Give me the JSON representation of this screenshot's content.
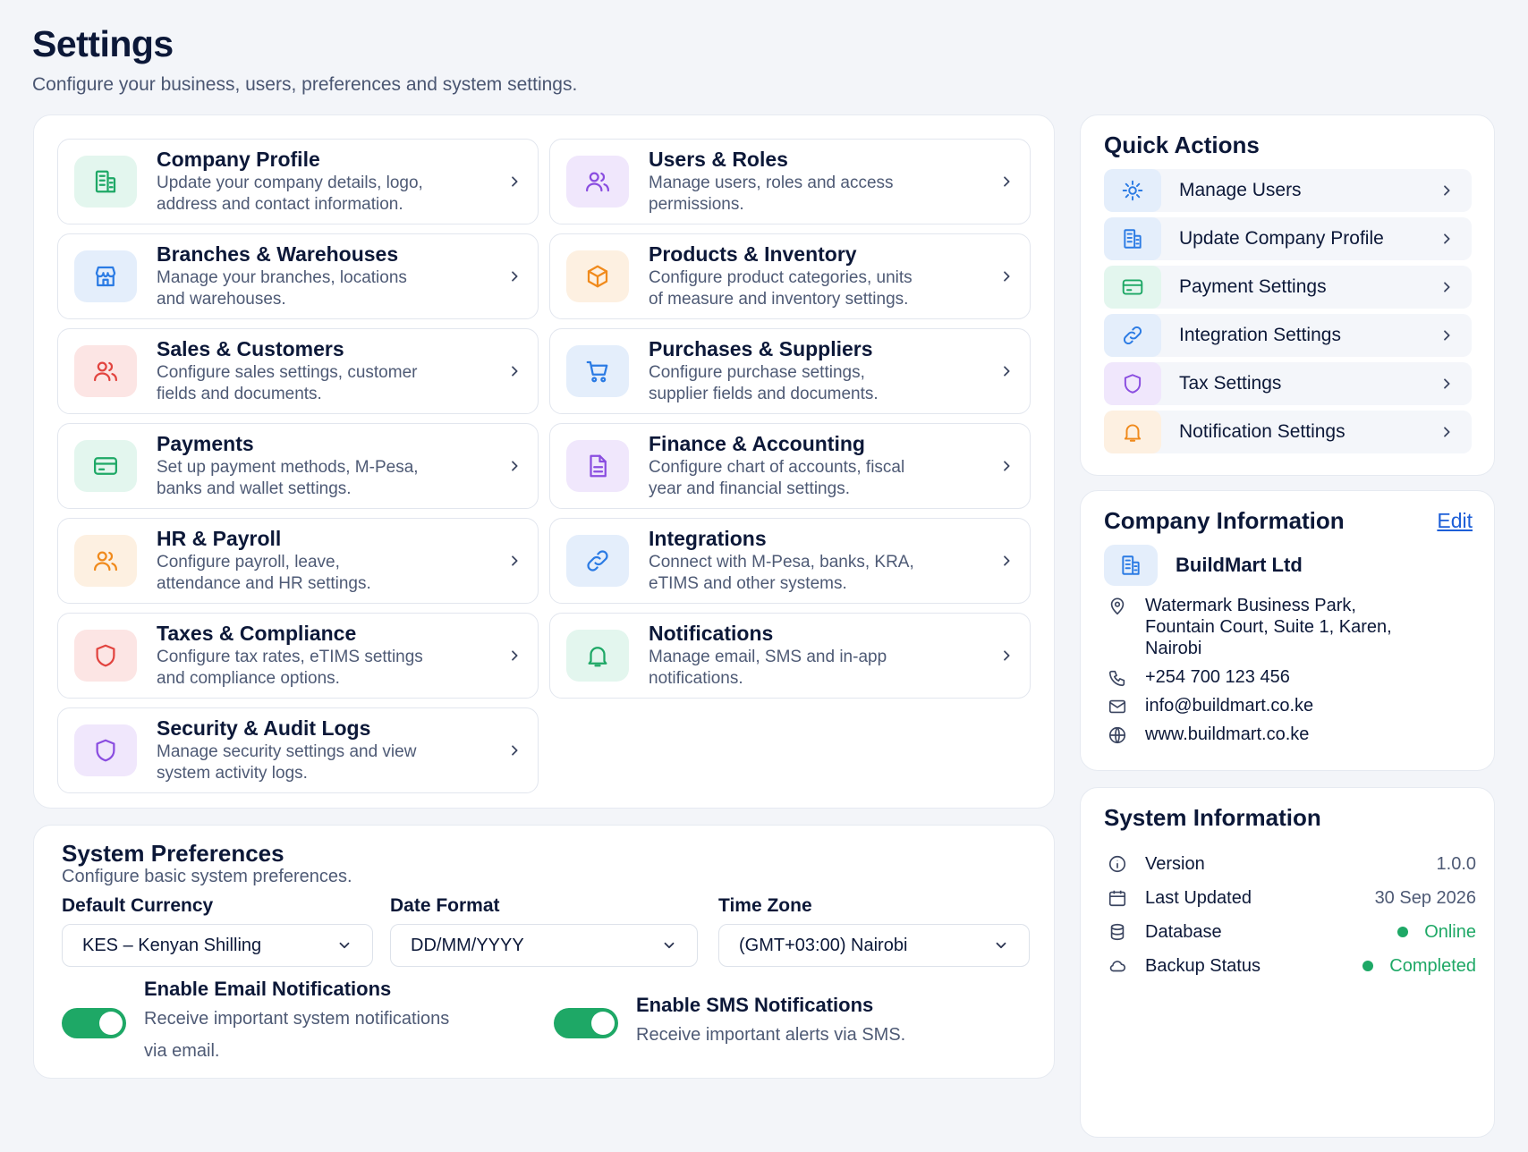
{
  "header": {
    "title": "Settings",
    "subtitle": "Configure your business, users, preferences and system settings."
  },
  "cards": [
    {
      "title": "Company Profile",
      "desc1": "Update your company details, logo,",
      "desc2": "address and contact information.",
      "icon": "building-icon",
      "color": "#1ea866",
      "bg": "#e3f6ee"
    },
    {
      "title": "Users & Roles",
      "desc1": "Manage users, roles and access",
      "desc2": "permissions.",
      "icon": "users-icon",
      "color": "#8a4de0",
      "bg": "#f0e7fc"
    },
    {
      "title": "Branches & Warehouses",
      "desc1": "Manage your branches, locations",
      "desc2": "and warehouses.",
      "icon": "store-icon",
      "color": "#2b7be4",
      "bg": "#e4eefb"
    },
    {
      "title": "Products & Inventory",
      "desc1": "Configure product categories, units",
      "desc2": "of measure and inventory settings.",
      "icon": "box-icon",
      "color": "#f08a1c",
      "bg": "#fdf0e1"
    },
    {
      "title": "Sales & Customers",
      "desc1": "Configure sales settings, customer",
      "desc2": "fields and documents.",
      "icon": "customers-icon",
      "color": "#e2443f",
      "bg": "#fce5e4"
    },
    {
      "title": "Purchases & Suppliers",
      "desc1": "Configure purchase settings,",
      "desc2": "supplier fields and documents.",
      "icon": "cart-icon",
      "color": "#2b7be4",
      "bg": "#e4eefb"
    },
    {
      "title": "Payments",
      "desc1": "Set up payment methods, M-Pesa,",
      "desc2": "banks and wallet settings.",
      "icon": "card-icon",
      "color": "#1ea866",
      "bg": "#e3f6ee"
    },
    {
      "title": "Finance & Accounting",
      "desc1": "Configure chart of accounts, fiscal",
      "desc2": "year and financial settings.",
      "icon": "document-icon",
      "color": "#8a4de0",
      "bg": "#f0e7fc"
    },
    {
      "title": "HR & Payroll",
      "desc1": "Configure payroll, leave,",
      "desc2": "attendance and HR settings.",
      "icon": "team-icon",
      "color": "#f08a1c",
      "bg": "#fdf0e1"
    },
    {
      "title": "Integrations",
      "desc1": "Connect with M-Pesa, banks, KRA,",
      "desc2": "eTIMS and other systems.",
      "icon": "link-icon",
      "color": "#2b7be4",
      "bg": "#e4eefb"
    },
    {
      "title": "Taxes & Compliance",
      "desc1": "Configure tax rates, eTIMS settings",
      "desc2": "and compliance options.",
      "icon": "shield-icon",
      "color": "#e2443f",
      "bg": "#fce5e4"
    },
    {
      "title": "Notifications",
      "desc1": "Manage email, SMS and in-app",
      "desc2": "notifications.",
      "icon": "bell-icon",
      "color": "#1ea866",
      "bg": "#e3f6ee"
    },
    {
      "title": "Security & Audit Logs",
      "desc1": "Manage security settings and view",
      "desc2": "system activity logs.",
      "icon": "shield-icon",
      "color": "#8a4de0",
      "bg": "#f0e7fc"
    }
  ],
  "quick_actions": {
    "title": "Quick Actions",
    "items": [
      {
        "label": "Manage Users",
        "icon": "gear-icon",
        "color": "#2b7be4",
        "bg": "#e4eefb"
      },
      {
        "label": "Update Company Profile",
        "icon": "building-icon",
        "color": "#2b7be4",
        "bg": "#e4eefb"
      },
      {
        "label": "Payment Settings",
        "icon": "card-icon",
        "color": "#1ea866",
        "bg": "#e3f6ee"
      },
      {
        "label": "Integration Settings",
        "icon": "link-icon",
        "color": "#2b7be4",
        "bg": "#e4eefb"
      },
      {
        "label": "Tax Settings",
        "icon": "shield-icon",
        "color": "#8a4de0",
        "bg": "#f0e7fc"
      },
      {
        "label": "Notification Settings",
        "icon": "bell-icon",
        "color": "#f08a1c",
        "bg": "#fdf0e1"
      }
    ]
  },
  "company_info": {
    "title": "Company Information",
    "edit_label": "Edit",
    "name": "BuildMart Ltd",
    "address_line1": "Watermark Business Park,",
    "address_line2": "Fountain Court, Suite 1, Karen,",
    "address_line3": "Nairobi",
    "phone": "+254 700 123 456",
    "email": "info@buildmart.co.ke",
    "website": "www.buildmart.co.ke"
  },
  "system_info": {
    "title": "System Information",
    "rows": [
      {
        "label": "Version",
        "value": "1.0.0"
      },
      {
        "label": "Last Updated",
        "value": "30 Sep 2026"
      },
      {
        "label": "Database",
        "value": "Online"
      },
      {
        "label": "Backup Status",
        "value": "Completed"
      }
    ]
  },
  "preferences": {
    "title": "System Preferences",
    "subtitle": "Configure basic system preferences.",
    "currency_label": "Default Currency",
    "currency_value": "KES – Kenyan Shilling",
    "date_label": "Date Format",
    "date_value": "DD/MM/YYYY",
    "tz_label": "Time Zone",
    "tz_value": "(GMT+03:00) Nairobi",
    "email_toggle_title": "Enable Email Notifications",
    "email_toggle_desc1": "Receive important system notifications",
    "email_toggle_desc2": "via email.",
    "sms_toggle_title": "Enable SMS Notifications",
    "sms_toggle_desc": "Receive important alerts via SMS."
  }
}
